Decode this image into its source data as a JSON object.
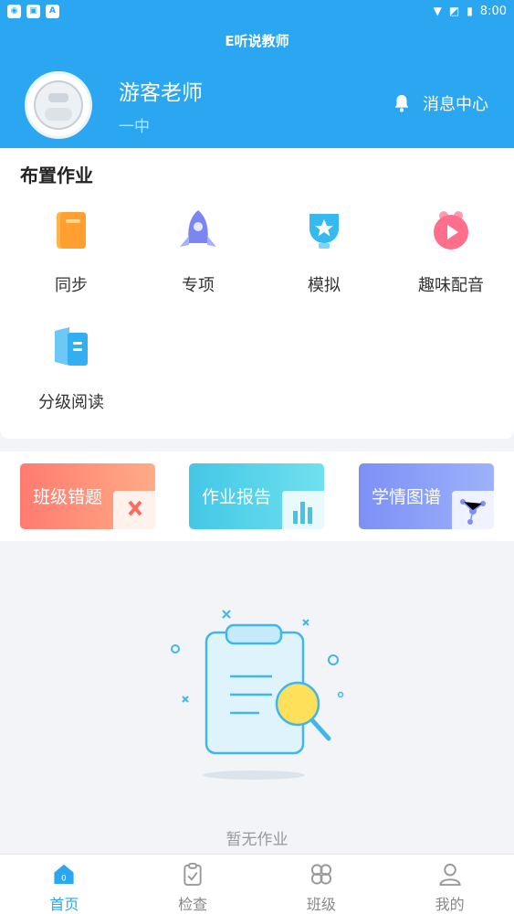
{
  "status_bar": {
    "time": "8:00"
  },
  "header": {
    "title": "E听说教师",
    "teacher_name": "游客老师",
    "school": "一中",
    "message_center": "消息中心"
  },
  "assign": {
    "title": "布置作业",
    "items": [
      {
        "label": "同步",
        "icon": "book-icon"
      },
      {
        "label": "专项",
        "icon": "rocket-icon"
      },
      {
        "label": "模拟",
        "icon": "trophy-icon"
      },
      {
        "label": "趣味配音",
        "icon": "play-icon"
      },
      {
        "label": "分级阅读",
        "icon": "open-book-icon"
      }
    ]
  },
  "banners": [
    {
      "label": "班级错题"
    },
    {
      "label": "作业报告"
    },
    {
      "label": "学情图谱"
    }
  ],
  "empty_state": {
    "text": "暂无作业"
  },
  "bottom_nav": [
    {
      "label": "首页",
      "active": true
    },
    {
      "label": "检查"
    },
    {
      "label": "班级"
    },
    {
      "label": "我的"
    }
  ],
  "colors": {
    "primary": "#2aa7f0",
    "banner_red": "#ff7b70",
    "banner_cyan": "#43c7e6",
    "banner_purple": "#7d90f5"
  }
}
